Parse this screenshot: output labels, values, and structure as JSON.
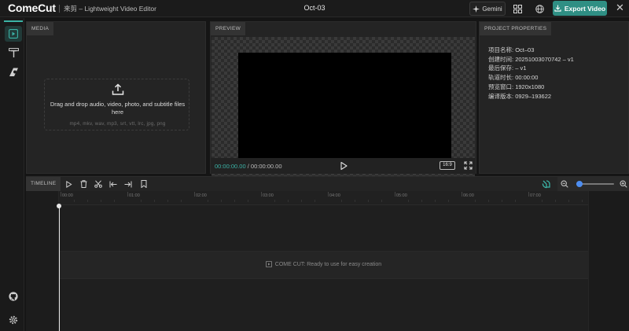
{
  "header": {
    "logo": "ComeCut",
    "subtitle": "来剪 – Lightweight Video Editor",
    "project_name": "Oct-03",
    "gemini_label": "Gemini",
    "export_label": "Export Video",
    "icons": {
      "gemini": "sparkle-icon",
      "layout": "grid-icon",
      "language": "globe-icon",
      "export": "download-icon",
      "close": "close-icon"
    }
  },
  "rail": {
    "items": [
      {
        "name": "media",
        "icon": "media-icon",
        "active": true
      },
      {
        "name": "text",
        "icon": "text-icon",
        "active": false
      },
      {
        "name": "effects",
        "icon": "effects-icon",
        "active": false
      }
    ],
    "bottom": [
      "github-icon",
      "gear-icon"
    ]
  },
  "media": {
    "tab": "MEDIA",
    "drop_text": "Drag and drop audio, video, photo, and subtitle files here",
    "formats": "mp4, mkv, wav, mp3, srt, vtt, lrc, jpg, png"
  },
  "preview": {
    "tab": "PREVIEW",
    "current_time": "00:00:00.00",
    "separator": "/",
    "total_time": "00:00:00.00",
    "aspect_ratio": "16:9"
  },
  "properties": {
    "tab": "PROJECT PROPERTIES",
    "rows": [
      {
        "key": "项目名称:",
        "value": "Oct–03"
      },
      {
        "key": "创建时间:",
        "value": "20251003070742 – v1"
      },
      {
        "key": "最后保存:",
        "value": "– v1"
      },
      {
        "key": "轨道时长:",
        "value": "00:00:00"
      },
      {
        "key": "预览窗口:",
        "value": "1920x1080"
      },
      {
        "key": "编译版本:",
        "value": "0929–193622"
      }
    ]
  },
  "timeline": {
    "tab": "TIMELINE",
    "ticks": [
      "00:00",
      "01:00",
      "02:00",
      "03:00",
      "04:00",
      "05:00",
      "06:00",
      "07:00"
    ],
    "hint": "COME CUT: Ready to use for easy creation",
    "zoom_level": 0.08
  },
  "colors": {
    "accent": "#3bb3a6",
    "export": "#2f8f84",
    "zoom": "#4d8df0"
  }
}
